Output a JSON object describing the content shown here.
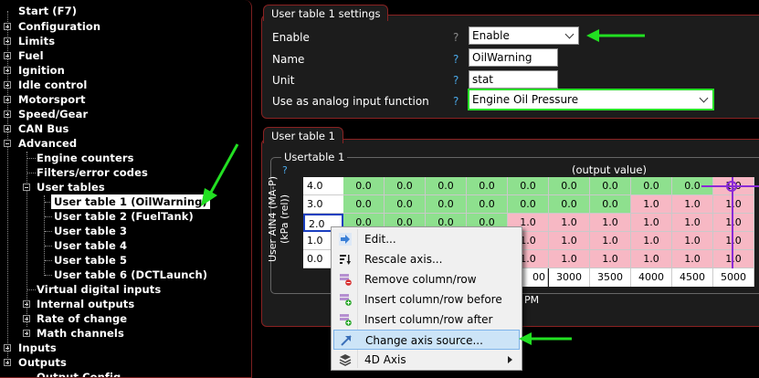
{
  "tree": {
    "items": [
      {
        "label": "Start (F7)",
        "expander": "none"
      },
      {
        "label": "Configuration",
        "expander": "plus"
      },
      {
        "label": "Limits",
        "expander": "plus"
      },
      {
        "label": "Fuel",
        "expander": "plus"
      },
      {
        "label": "Ignition",
        "expander": "plus"
      },
      {
        "label": "Idle control",
        "expander": "plus"
      },
      {
        "label": "Motorsport",
        "expander": "plus"
      },
      {
        "label": "Speed/Gear",
        "expander": "plus"
      },
      {
        "label": "CAN Bus",
        "expander": "plus"
      },
      {
        "label": "Advanced",
        "expander": "minus"
      },
      {
        "label": "Engine counters",
        "expander": "none"
      },
      {
        "label": "Filters/error codes",
        "expander": "none"
      },
      {
        "label": "User tables",
        "expander": "minus"
      },
      {
        "label": "User table 1 (OilWarning)",
        "expander": "none",
        "selected": true
      },
      {
        "label": "User table 2 (FuelTank)",
        "expander": "none"
      },
      {
        "label": "User table 3",
        "expander": "none"
      },
      {
        "label": "User table 4",
        "expander": "none"
      },
      {
        "label": "User table 5",
        "expander": "none"
      },
      {
        "label": "User table 6 (DCTLaunch)",
        "expander": "none"
      },
      {
        "label": "Virtual digital inputs",
        "expander": "none"
      },
      {
        "label": "Internal outputs",
        "expander": "plus"
      },
      {
        "label": "Rate of change",
        "expander": "plus"
      },
      {
        "label": "Math channels",
        "expander": "plus"
      },
      {
        "label": "Inputs",
        "expander": "plus"
      },
      {
        "label": "Outputs",
        "expander": "plus"
      },
      {
        "label": "Output Config",
        "expander": "none"
      }
    ]
  },
  "settings": {
    "tab_label": "User table 1 settings",
    "enable_label": "Enable",
    "enable_value": "Enable",
    "name_label": "Name",
    "name_value": "OilWarning",
    "unit_label": "Unit",
    "unit_value": "stat",
    "analog_label": "Use as analog input function",
    "analog_value": "Engine Oil Pressure",
    "help": "?"
  },
  "table_panel": {
    "tab_label": "User table 1",
    "group_label": "Usertable 1",
    "help": "?",
    "output_label": "(output value)",
    "y_axis_label": "User AIN4 (MA-P) (kPa (rel))",
    "x_axis_unit": "PM",
    "y_values": [
      "4.0",
      "3.0",
      "2.0",
      "1.0",
      "0.0"
    ],
    "x_values": [
      "3000",
      "3500",
      "4000",
      "4500",
      "5000"
    ],
    "x_partial": "00",
    "rows": [
      [
        "0.0",
        "0.0",
        "0.0",
        "0.0",
        "0.0",
        "0.0",
        "0.0",
        "0.0",
        "0.0",
        "1.0"
      ],
      [
        "0.0",
        "0.0",
        "0.0",
        "0.0",
        "0.0",
        "0.0",
        "0.0",
        "1.0",
        "1.0",
        "1.0"
      ],
      [
        "0.0",
        "0.0",
        "0.0",
        "0.0",
        "1.0",
        "1.0",
        "1.0",
        "1.0",
        "1.0",
        "1.0"
      ],
      [
        "",
        "",
        "",
        "",
        "1.0",
        "1.0",
        "1.0",
        "1.0",
        "1.0",
        "1.0"
      ],
      [
        "",
        "",
        "",
        "",
        "1.0",
        "1.0",
        "1.0",
        "1.0",
        "1.0",
        "1.0"
      ]
    ]
  },
  "context_menu": {
    "items": [
      {
        "label": "Edit...",
        "icon": "arrow-right-icon"
      },
      {
        "label": "Rescale axis...",
        "icon": "rescale-icon"
      },
      {
        "label": "Remove column/row",
        "icon": "remove-icon"
      },
      {
        "label": "Insert column/row before",
        "icon": "insert-icon"
      },
      {
        "label": "Insert column/row after",
        "icon": "insert-icon"
      },
      {
        "label": "Change axis source...",
        "icon": "axis-source-icon",
        "highlighted": true
      },
      {
        "label": "4D Axis",
        "icon": "layers-icon",
        "submenu": true
      }
    ]
  },
  "colors": {
    "green_cell": "#8ee08e",
    "pink_cell": "#f7b8c4",
    "panel_border": "#8a2222",
    "annotation_arrow": "#22e022",
    "marker": "#8a2ad6"
  }
}
